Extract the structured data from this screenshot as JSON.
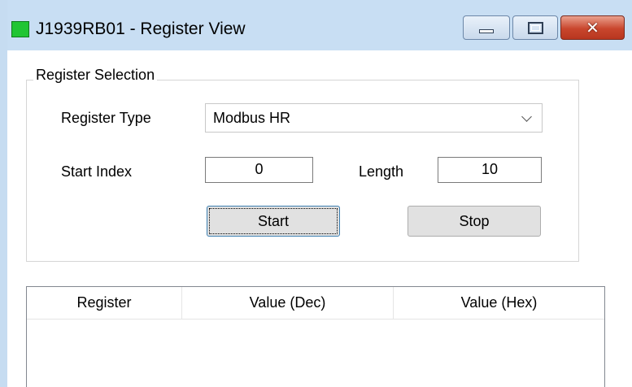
{
  "window": {
    "title": "J1939RB01 - Register View",
    "app_icon_color": "#20c534",
    "controls": [
      "minimize",
      "maximize",
      "close"
    ]
  },
  "register_selection": {
    "group_title": "Register Selection",
    "register_type_label": "Register Type",
    "register_type_value": "Modbus HR",
    "start_index_label": "Start Index",
    "start_index_value": "0",
    "length_label": "Length",
    "length_value": "10",
    "start_button": "Start",
    "stop_button": "Stop"
  },
  "register_table": {
    "columns": [
      "Register",
      "Value (Dec)",
      "Value (Hex)"
    ],
    "rows": []
  }
}
